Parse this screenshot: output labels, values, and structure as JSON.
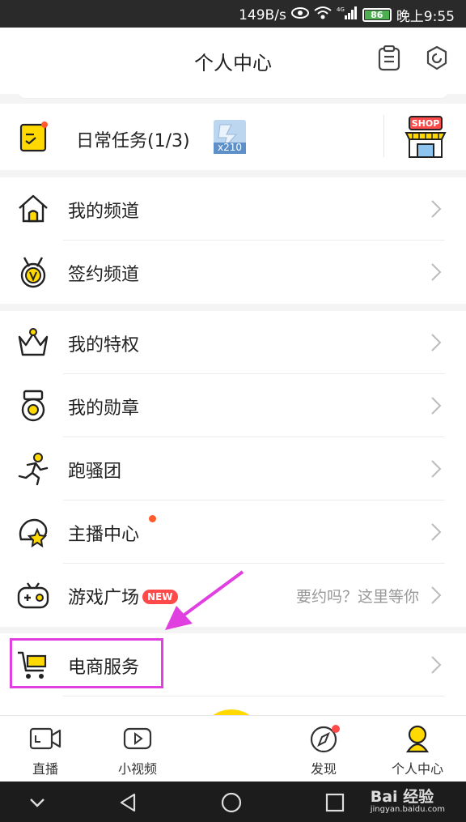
{
  "status_bar": {
    "network_speed": "149B/s",
    "battery_level": "86",
    "time": "晚上9:55"
  },
  "header": {
    "title": "个人中心"
  },
  "daily_task": {
    "label": "日常任务(1/3)",
    "reward_count": "x210",
    "shop_label": "SHOP"
  },
  "menu": {
    "my_channel": "我的频道",
    "signed_channel": "签约频道",
    "my_privilege": "我的特权",
    "my_medals": "我的勋章",
    "run_group": "跑骚团",
    "streamer_center": "主播中心",
    "game_plaza": "游戏广场",
    "game_plaza_badge": "NEW",
    "game_plaza_hint": "要约吗？这里等你",
    "ecommerce": "电商服务"
  },
  "bottom_nav": {
    "live": "直播",
    "short_video": "小视频",
    "discover": "发现",
    "profile": "个人中心"
  },
  "watermark": {
    "brand": "Bai 经验",
    "url": "jingyan.baidu.com"
  },
  "colors": {
    "accent": "#ffd900",
    "highlight": "#e040e0",
    "badge_red": "#ff4a4a"
  }
}
